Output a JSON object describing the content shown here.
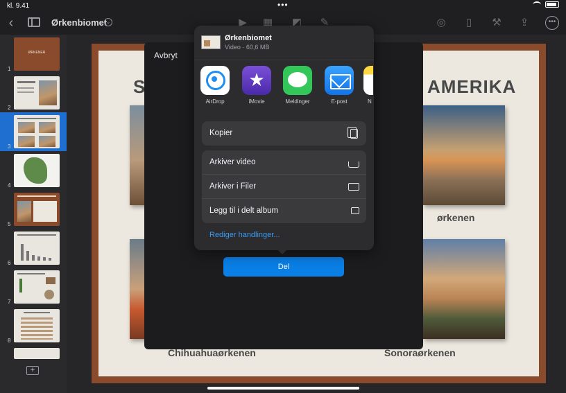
{
  "status": {
    "time": "kl. 9.41"
  },
  "toolbar": {
    "title": "Ørkenbiomet"
  },
  "navigator": {
    "slides": [
      {
        "num": "1",
        "title": "ØRKENER"
      },
      {
        "num": "2"
      },
      {
        "num": "3"
      },
      {
        "num": "4"
      },
      {
        "num": "5"
      },
      {
        "num": "6"
      },
      {
        "num": "7"
      },
      {
        "num": "8"
      }
    ]
  },
  "slide": {
    "heading_left": "ST",
    "heading_right": "AMERIKA",
    "caption_top_right": "ørkenen",
    "caption_bottom_left": "Chihuahuaørkenen",
    "caption_bottom_right": "Sonoraørkenen"
  },
  "sheet": {
    "cancel": "Avbryt",
    "share_button": "Del"
  },
  "share": {
    "file_name": "Ørkenbiomet",
    "file_meta": "Video · 60,6 MB",
    "apps": [
      {
        "label": "AirDrop"
      },
      {
        "label": "iMovie"
      },
      {
        "label": "Meldinger"
      },
      {
        "label": "E-post"
      },
      {
        "label": "N"
      }
    ],
    "copy": "Kopier",
    "save_video": "Arkiver video",
    "save_files": "Arkiver i Filer",
    "add_shared_album": "Legg til i delt album",
    "edit_actions": "Rediger handlinger..."
  },
  "colors": {
    "accent": "#0a7fe6",
    "link": "#3a9bf0",
    "slide_border": "#8a4a2c"
  }
}
